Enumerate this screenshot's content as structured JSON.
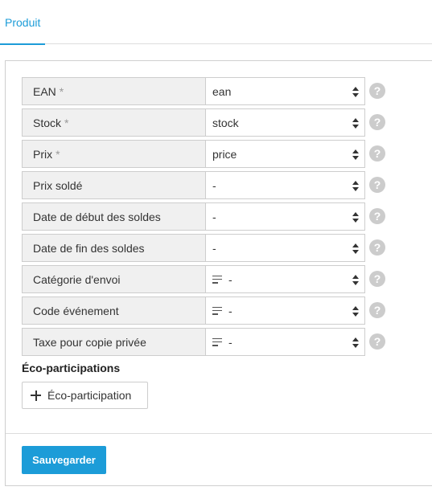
{
  "tabs": {
    "active_label": "Produit"
  },
  "form": {
    "fields": [
      {
        "label": "EAN",
        "required": "*",
        "value": "ean",
        "icon": ""
      },
      {
        "label": "Stock",
        "required": "*",
        "value": "stock",
        "icon": ""
      },
      {
        "label": "Prix",
        "required": "*",
        "value": "price",
        "icon": ""
      },
      {
        "label": "Prix soldé",
        "required": "",
        "value": "-",
        "icon": ""
      },
      {
        "label": "Date de début des soldes",
        "required": "",
        "value": "-",
        "icon": ""
      },
      {
        "label": "Date de fin des soldes",
        "required": "",
        "value": "-",
        "icon": ""
      },
      {
        "label": "Catégorie d'envoi",
        "required": "",
        "value": "-",
        "icon": "list-icon"
      },
      {
        "label": "Code événement",
        "required": "",
        "value": "-",
        "icon": "list-icon"
      },
      {
        "label": "Taxe pour copie privée",
        "required": "",
        "value": "-",
        "icon": "list-icon"
      }
    ],
    "help_glyph": "?",
    "eco_section_title": "Éco-participations",
    "eco_add_label": "Éco-participation",
    "save_label": "Sauvegarder"
  },
  "colors": {
    "accent": "#1c9cd8",
    "label_bg": "#f0f0f0",
    "border": "#cdcdcd",
    "help_bg": "#cccccc"
  }
}
